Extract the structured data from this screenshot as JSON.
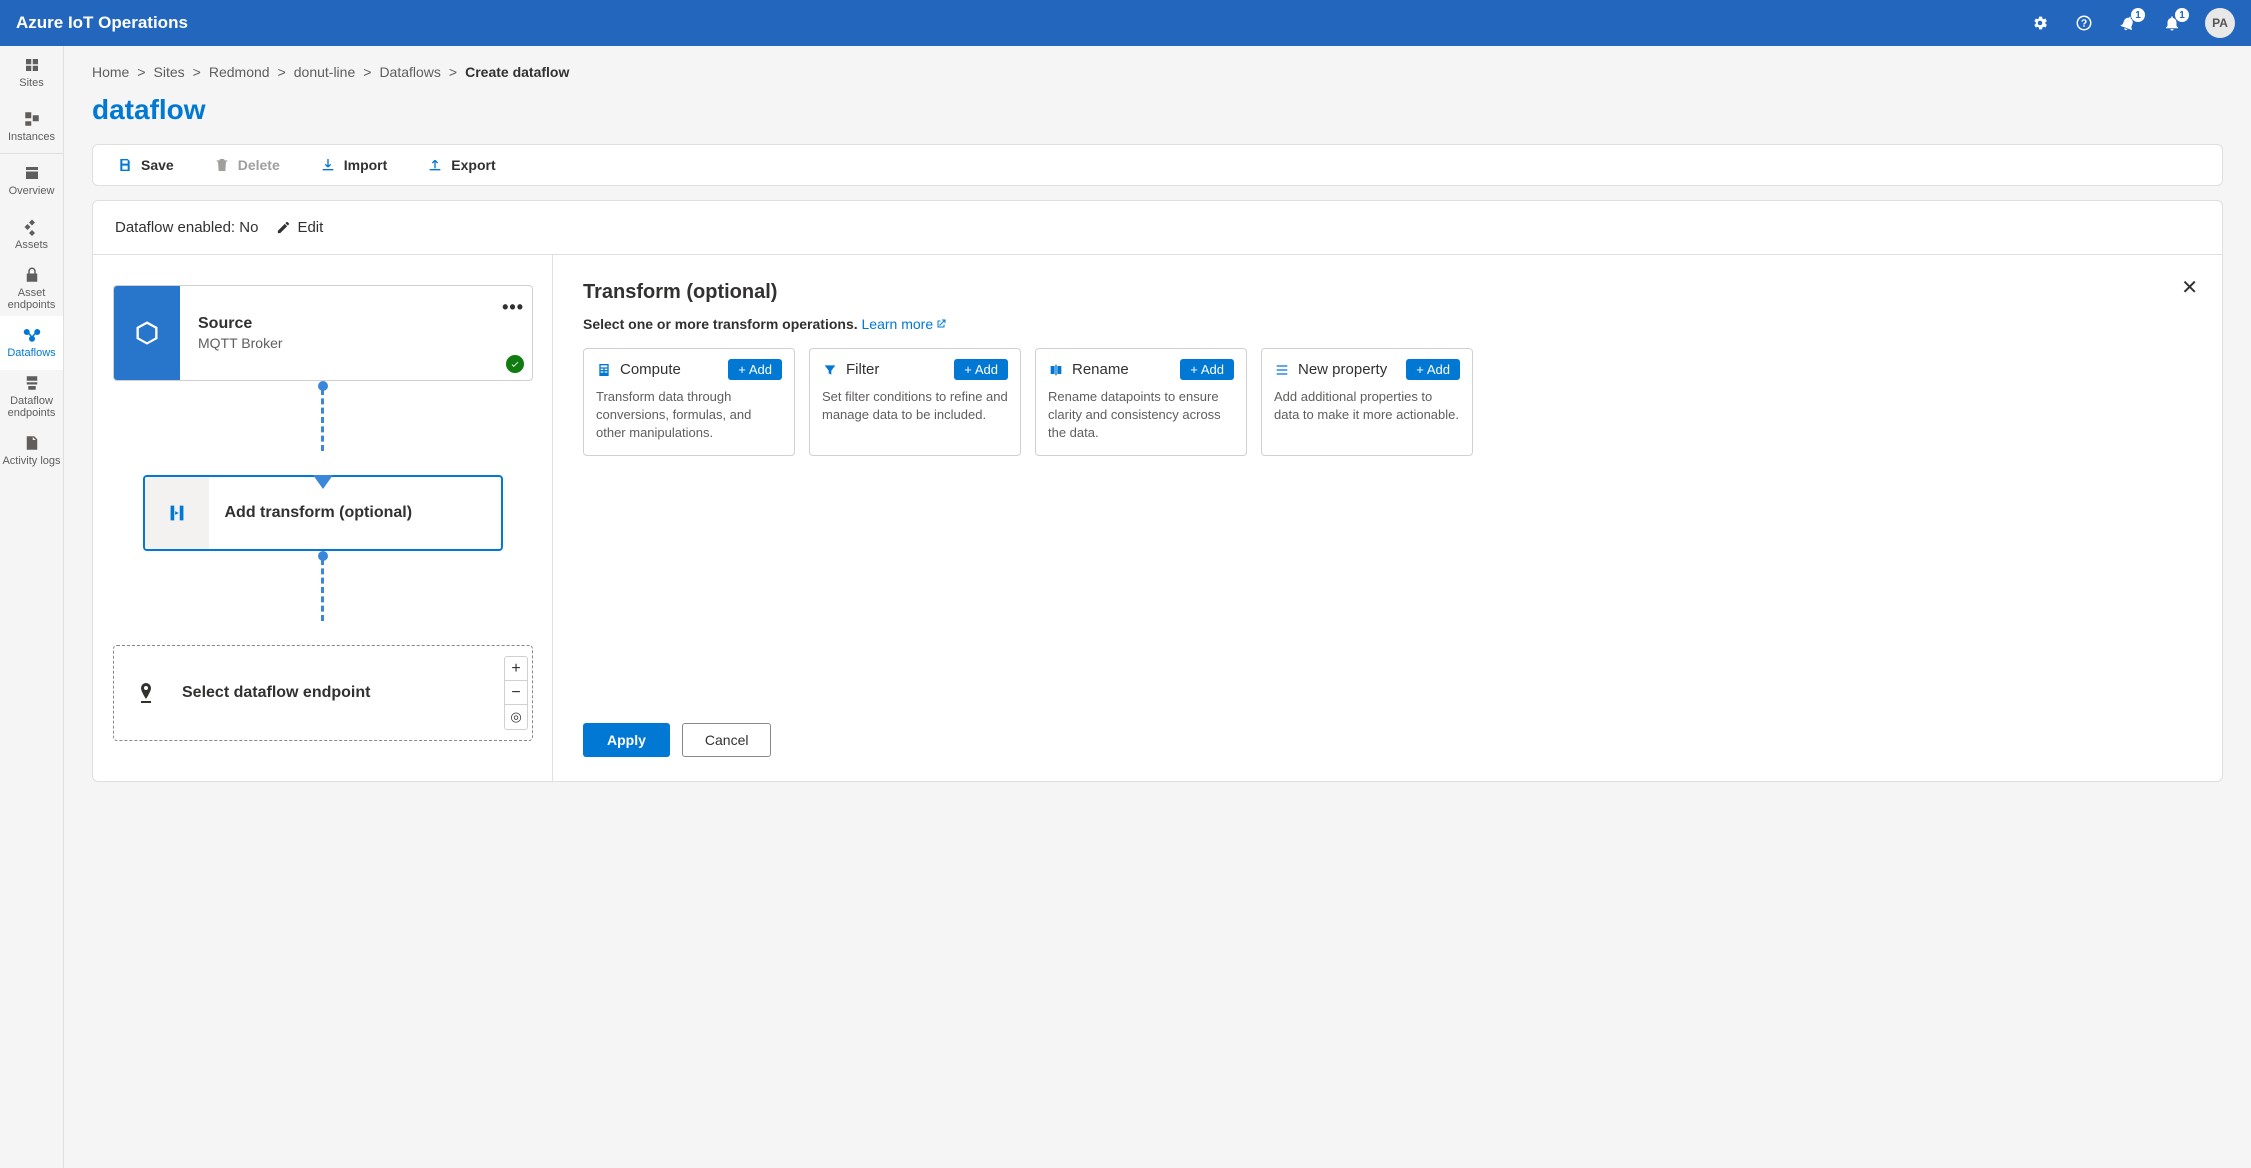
{
  "header": {
    "app_title": "Azure IoT Operations",
    "notification_badge_1": "1",
    "notification_badge_2": "1",
    "avatar_initials": "PA"
  },
  "sidebar": {
    "items": [
      {
        "label": "Sites"
      },
      {
        "label": "Instances"
      },
      {
        "label": "Overview"
      },
      {
        "label": "Assets"
      },
      {
        "label": "Asset endpoints"
      },
      {
        "label": "Dataflows"
      },
      {
        "label": "Dataflow endpoints"
      },
      {
        "label": "Activity logs"
      }
    ]
  },
  "breadcrumb": {
    "items": [
      "Home",
      "Sites",
      "Redmond",
      "donut-line",
      "Dataflows"
    ],
    "current": "Create dataflow"
  },
  "page_title": "dataflow",
  "toolbar": {
    "save": "Save",
    "delete": "Delete",
    "import": "Import",
    "export": "Export"
  },
  "status": {
    "label": "Dataflow enabled: No",
    "edit": "Edit"
  },
  "canvas": {
    "source": {
      "title": "Source",
      "subtitle": "MQTT Broker"
    },
    "transform": {
      "label": "Add transform (optional)"
    },
    "endpoint": {
      "label": "Select dataflow endpoint"
    }
  },
  "detail": {
    "title": "Transform (optional)",
    "hint_text": "Select one or more transform operations. ",
    "learn_more": "Learn more",
    "ops": [
      {
        "name": "Compute",
        "desc": "Transform data through conversions, formulas, and other manipulations.",
        "add": "Add"
      },
      {
        "name": "Filter",
        "desc": "Set filter conditions to refine and manage data to be included.",
        "add": "Add"
      },
      {
        "name": "Rename",
        "desc": "Rename datapoints to ensure clarity and consistency across the data.",
        "add": "Add"
      },
      {
        "name": "New property",
        "desc": "Add additional properties to data to make it more actionable.",
        "add": "Add"
      }
    ],
    "apply": "Apply",
    "cancel": "Cancel"
  }
}
